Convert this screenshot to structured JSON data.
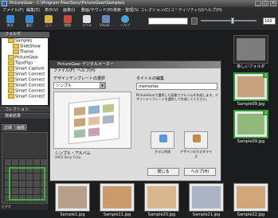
{
  "window": {
    "title": "PictureGear - C:\\Program Files\\Sony\\PictureGear\\Samples\\",
    "controls": [
      "_",
      "□",
      "×"
    ]
  },
  "menu": {
    "items": [
      "ファイル(F)",
      "編集(E)",
      "表示(V)",
      "画像(I)",
      "動画/サウンド(M)",
      "検索・整理(S)",
      "コレクション(C)",
      "ユーティリティ(U)",
      "ヘルプ(H)"
    ]
  },
  "toolbar": {
    "buttons": [
      {
        "label": "戻る",
        "icon": "back-icon"
      },
      {
        "label": "進む",
        "icon": "forward-icon"
      },
      {
        "label": "上へ",
        "icon": "up-icon"
      },
      {
        "label": "削除",
        "icon": "delete-icon"
      },
      {
        "label": "ラベル",
        "icon": "label-icon"
      },
      {
        "label": "Visual...",
        "icon": "visual-icon"
      },
      {
        "label": "ヘルプ",
        "icon": "help-icon"
      }
    ],
    "zoom": "100"
  },
  "left_panel": {
    "folder_header": "フォルダ",
    "tree": [
      {
        "label": "Samples",
        "level": 2
      },
      {
        "label": "SlideShow",
        "level": 3
      },
      {
        "label": "Theme",
        "level": 3
      },
      {
        "label": "PictureGear",
        "level": 2
      },
      {
        "label": "Tips(Ftp)",
        "level": 2
      },
      {
        "label": "Smart Capture",
        "level": 2
      },
      {
        "label": "Smart Connect",
        "level": 2
      },
      {
        "label": "Smart Connect",
        "level": 2
      },
      {
        "label": "Smart Connect",
        "level": 2
      },
      {
        "label": "Smart Connect",
        "level": 2
      },
      {
        "label": "Smart Connect",
        "level": 2
      }
    ],
    "sections": [
      "コレクション",
      "検索結果"
    ],
    "tabs": [
      "詳細",
      "画像"
    ],
    "bottom_tab": "ビデオ"
  },
  "thumbnails": [
    {
      "label": "新しいフォルダ",
      "kind": "folder"
    },
    {
      "label": "Sample09.jpg",
      "kind": "photo",
      "badge": "3"
    },
    {
      "label": "Sample09.jpg",
      "kind": "photo",
      "badge": "3"
    },
    {
      "label": "Sample1.jpg",
      "kind": "photo"
    },
    {
      "label": "Sample11.jpg",
      "kind": "photo"
    },
    {
      "label": "Sample20.jpg",
      "kind": "photo"
    },
    {
      "label": "Sample21.jpg",
      "kind": "photo"
    },
    {
      "label": "Sample22.jpg",
      "kind": "photo"
    }
  ],
  "dialog": {
    "title": "PictureGear デジタルメーカー",
    "menu": [
      "ファイル(F)",
      "ヘルプ(H)"
    ],
    "template_label": "デザインテンプレートの選択",
    "template_value": "シンプル",
    "template_name": "シンプル・アルバム",
    "copyright": "2003 Sony Corp.",
    "title_label": "タイトルの編集",
    "title_value": "memories",
    "info_text": "PictureGearで選択した画像でアルバムを作成します。デザインテンプレートを選択して作成してください。",
    "make_now_label": "すぐに作成",
    "customize_label": "デザインのカスタマイズ",
    "close_button": "閉じる",
    "help_button": "ヘルプ(H)"
  }
}
